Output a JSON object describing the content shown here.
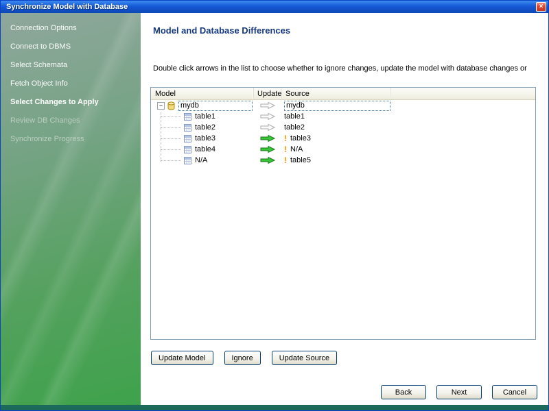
{
  "window": {
    "title": "Synchronize Model with Database",
    "close_glyph": "×"
  },
  "sidebar": {
    "steps": [
      {
        "label": "Connection Options",
        "state": "done"
      },
      {
        "label": "Connect to DBMS",
        "state": "done"
      },
      {
        "label": "Select Schemata",
        "state": "done"
      },
      {
        "label": "Fetch Object Info",
        "state": "done"
      },
      {
        "label": "Select Changes to Apply",
        "state": "current"
      },
      {
        "label": "Review DB Changes",
        "state": "pending"
      },
      {
        "label": "Synchronize Progress",
        "state": "pending"
      }
    ]
  },
  "main": {
    "heading": "Model and Database Differences",
    "instruction": "Double click arrows in the list to choose whether to ignore changes, update the model with database changes or",
    "table": {
      "columns": [
        "Model",
        "Update",
        "Source"
      ],
      "rows": [
        {
          "model": "mydb",
          "icon": "database-icon",
          "level": 0,
          "expander": "−",
          "arrow": "neutral",
          "source": "mydb",
          "source_warning": false,
          "focused": true
        },
        {
          "model": "table1",
          "icon": "table-icon",
          "level": 1,
          "arrow": "neutral",
          "source": "table1",
          "source_warning": false,
          "focused": false
        },
        {
          "model": "table2",
          "icon": "table-icon",
          "level": 1,
          "arrow": "neutral",
          "source": "table2",
          "source_warning": false,
          "focused": false
        },
        {
          "model": "table3",
          "icon": "table-icon",
          "level": 1,
          "arrow": "green",
          "source": "table3",
          "source_warning": true,
          "focused": false
        },
        {
          "model": "table4",
          "icon": "table-icon",
          "level": 1,
          "arrow": "green",
          "source": "N/A",
          "source_warning": true,
          "focused": false
        },
        {
          "model": "N/A",
          "icon": "table-icon",
          "level": 1,
          "arrow": "green",
          "source": "table5",
          "source_warning": true,
          "focused": false
        }
      ]
    },
    "action_buttons": [
      "Update Model",
      "Ignore",
      "Update Source"
    ],
    "nav_buttons": [
      "Back",
      "Next",
      "Cancel"
    ]
  },
  "colors": {
    "titlebar_blue": "#1659D6",
    "sidebar_green": "#55A15F",
    "heading_navy": "#16397E",
    "arrow_green": "#38C538",
    "warning_orange": "#FF8A00",
    "bottom_strip": "#1B6A5A"
  }
}
